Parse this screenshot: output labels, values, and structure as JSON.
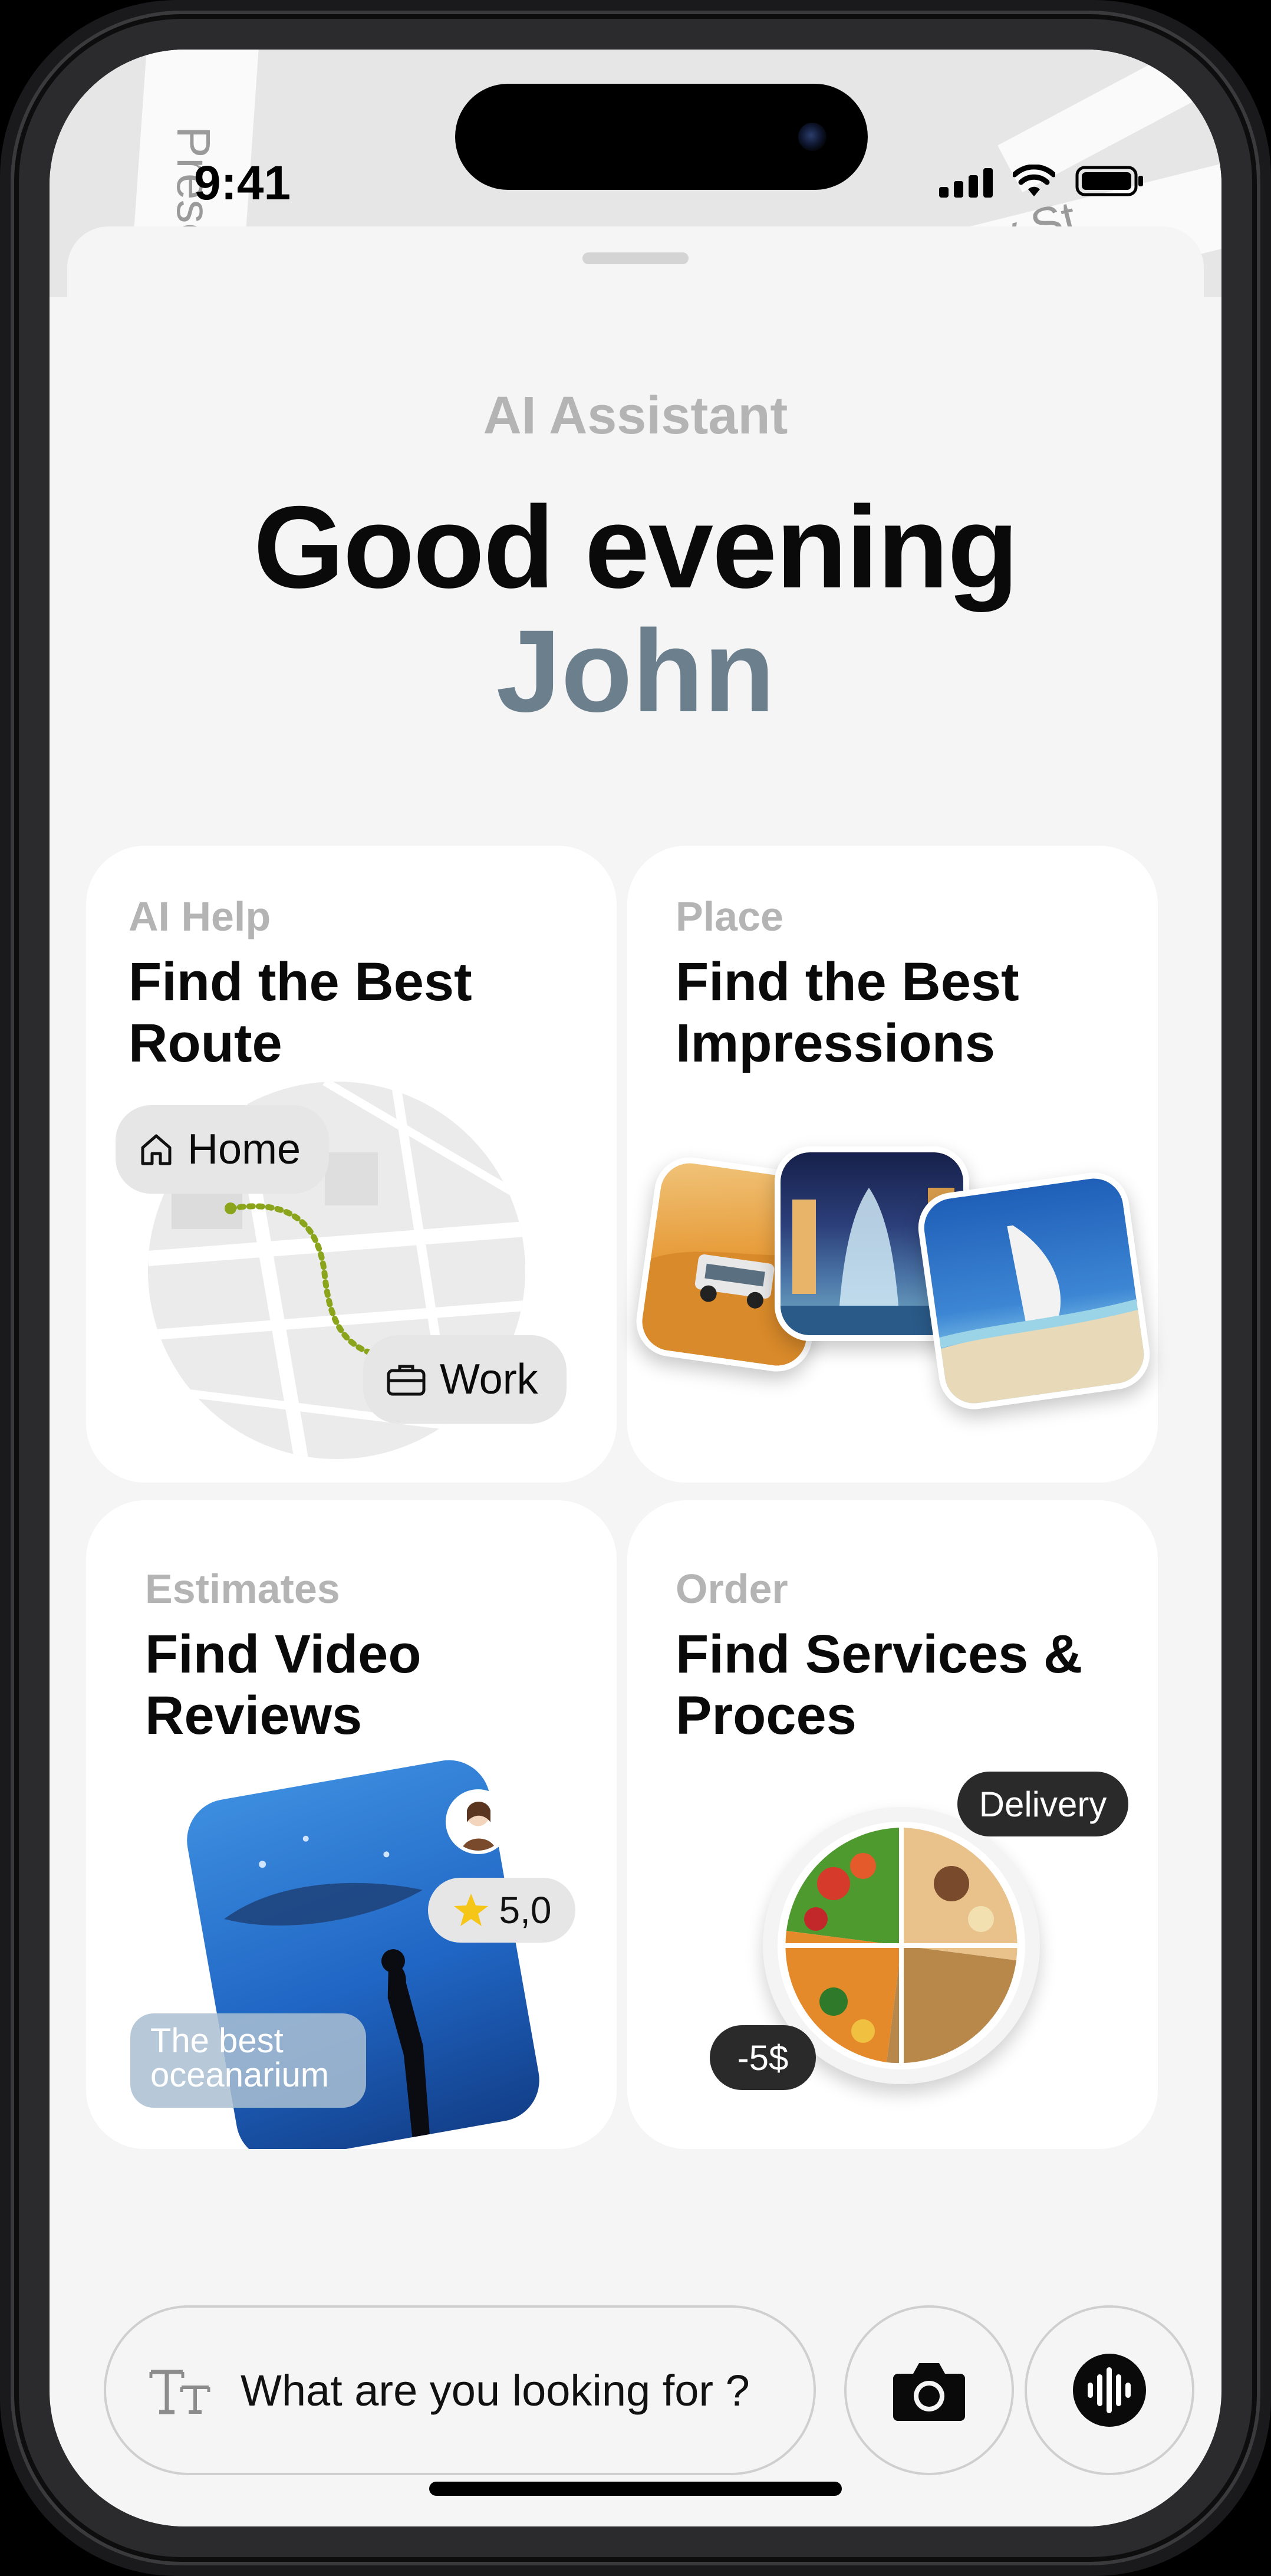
{
  "status": {
    "time": "9:41"
  },
  "map_bg": {
    "street1": "Presc",
    "street2": "ay St"
  },
  "header": {
    "eyebrow": "AI Assistant",
    "greeting": "Good evening",
    "name": "John"
  },
  "cards": [
    {
      "tag": "AI Help",
      "title": "Find the Best Route",
      "chip_home": "Home",
      "chip_work": "Work"
    },
    {
      "tag": "Place",
      "title": "Find the Best Impressions"
    },
    {
      "tag": "Estimates",
      "title": "Find Video Reviews",
      "rating": "5,0",
      "caption": "The best oceanarium"
    },
    {
      "tag": "Order",
      "title": "Find Services & Proces",
      "badge_delivery": "Delivery",
      "badge_discount": "-5$"
    }
  ],
  "search": {
    "placeholder": "What are you looking for ?"
  },
  "icons": {
    "text": "text-format-icon",
    "camera": "camera-icon",
    "voice": "voice-waveform-icon"
  },
  "colors": {
    "name_accent": "#6c7f8d",
    "route_dash": "#8aa51c",
    "rating_star": "#f5c518"
  }
}
